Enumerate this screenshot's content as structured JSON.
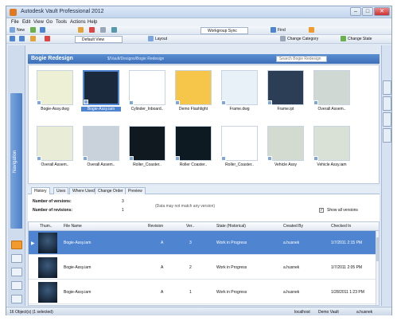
{
  "window": {
    "title": "Autodesk Vault Professional 2012"
  },
  "menu": [
    "File",
    "Edit",
    "View",
    "Go",
    "Tools",
    "Actions",
    "Help"
  ],
  "toolbar1": {
    "new_label": "New",
    "dropdown_text": "Workgroup Sync",
    "find_label": "Find"
  },
  "toolbar2": {
    "view_dropdown": "Default View",
    "layout_label": "Layout",
    "category_label": "Change Category",
    "state_label": "Change State"
  },
  "path": {
    "folder": "Bogie Redesign",
    "full": "$/Vault/Designs/Bogie Redesign",
    "search_placeholder": "Search Bogie Redesign"
  },
  "files": [
    {
      "name": "Bogie-Assy.dwg",
      "color": "#eef0d6"
    },
    {
      "name": "Bogie-Assy.iam",
      "color": "#1a2a3c"
    },
    {
      "name": "Cylinder_Inboard..",
      "color": "#ffffff"
    },
    {
      "name": "Demo Flashlight",
      "color": "#f6c64a"
    },
    {
      "name": "Frame.dwg",
      "color": "#e9f1f8"
    },
    {
      "name": "Frame.ipt",
      "color": "#2c3e55"
    },
    {
      "name": "Overall Assem..",
      "color": "#cfd8d2"
    },
    {
      "name": "Overall Assem..",
      "color": "#e9edd8"
    },
    {
      "name": "Overall Assem..",
      "color": "#c9d2db"
    },
    {
      "name": "Roller_Coaster..",
      "color": "#101820"
    },
    {
      "name": "Roller Coaster..",
      "color": "#0e1a22"
    },
    {
      "name": "Roller_Coaster..",
      "color": "#ffffff"
    },
    {
      "name": "Vehicle Assy",
      "color": "#d3dbd0"
    },
    {
      "name": "Vehicle Assy.iam",
      "color": "#d9e1d6"
    }
  ],
  "detail_tabs": [
    "History",
    "Uses",
    "Where Used",
    "Change Order",
    "Preview"
  ],
  "summary": {
    "versions_label": "Number of versions:",
    "versions_value": "3",
    "revisions_label": "Number of revisions:",
    "revisions_value": "1",
    "note": "(Data may not match any version)",
    "show_all": "Show all versions"
  },
  "grid": {
    "headers": [
      "Thum..",
      "File Name",
      "Revision",
      "Ver..",
      "State (Historical)",
      "Created By",
      "Checked In"
    ],
    "rows": [
      {
        "name": "Bogie-Assy.iam",
        "rev": "A",
        "ver": "3",
        "state": "Work in Progress",
        "by": "a.husnek",
        "date": "1/7/2011 2:15 PM"
      },
      {
        "name": "Bogie-Assy.iam",
        "rev": "A",
        "ver": "2",
        "state": "Work in Progress",
        "by": "a.husnek",
        "date": "1/7/2011 2:05 PM"
      },
      {
        "name": "Bogie-Assy.iam",
        "rev": "A",
        "ver": "1",
        "state": "Work in Progress",
        "by": "a.husnek",
        "date": "1/28/2011 1:23 PM"
      }
    ]
  },
  "status": {
    "left": "16 Object(s) (1 selected)",
    "server": "localhost",
    "vault": "Demo Vault",
    "user": "a.husnek"
  }
}
